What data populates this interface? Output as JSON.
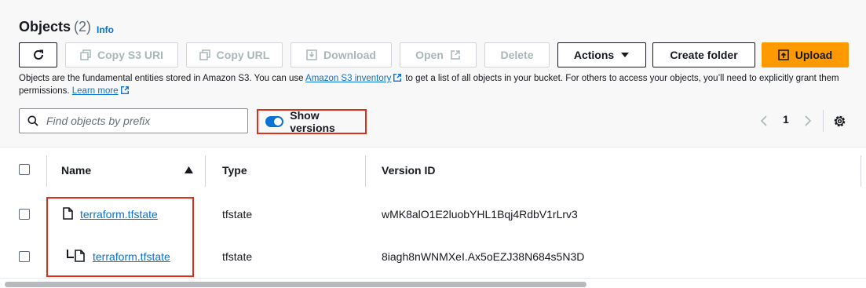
{
  "header": {
    "title": "Objects",
    "count": "(2)",
    "info": "Info"
  },
  "toolbar": {
    "copy_s3_uri": "Copy S3 URI",
    "copy_url": "Copy URL",
    "download": "Download",
    "open": "Open",
    "delete": "Delete",
    "actions": "Actions",
    "create_folder": "Create folder",
    "upload": "Upload"
  },
  "description": {
    "part1": "Objects are the fundamental entities stored in Amazon S3. You can use",
    "inventory_link": "Amazon S3 inventory",
    "part2": "to get a list of all objects in your bucket. For others to access your objects, you’ll need to explicitly grant them permissions.",
    "learn_more": "Learn more"
  },
  "search": {
    "placeholder": "Find objects by prefix"
  },
  "versions_toggle": {
    "label": "Show versions",
    "enabled": true
  },
  "pagination": {
    "page": "1"
  },
  "table": {
    "columns": [
      "Name",
      "Type",
      "Version ID"
    ],
    "rows": [
      {
        "name": "terraform.tfstate",
        "type": "tfstate",
        "version_id": "wMK8alO1E2luobYHL1Bqj4RdbV1rLrv3"
      },
      {
        "name": "terraform.tfstate",
        "type": "tfstate",
        "version_id": "8iagh8nWNMXeI.Ax5oEZJ38N684s5N3D"
      }
    ]
  },
  "colors": {
    "accent": "#0972d3",
    "upload": "#ff9900",
    "highlight": "#e02e1a"
  }
}
